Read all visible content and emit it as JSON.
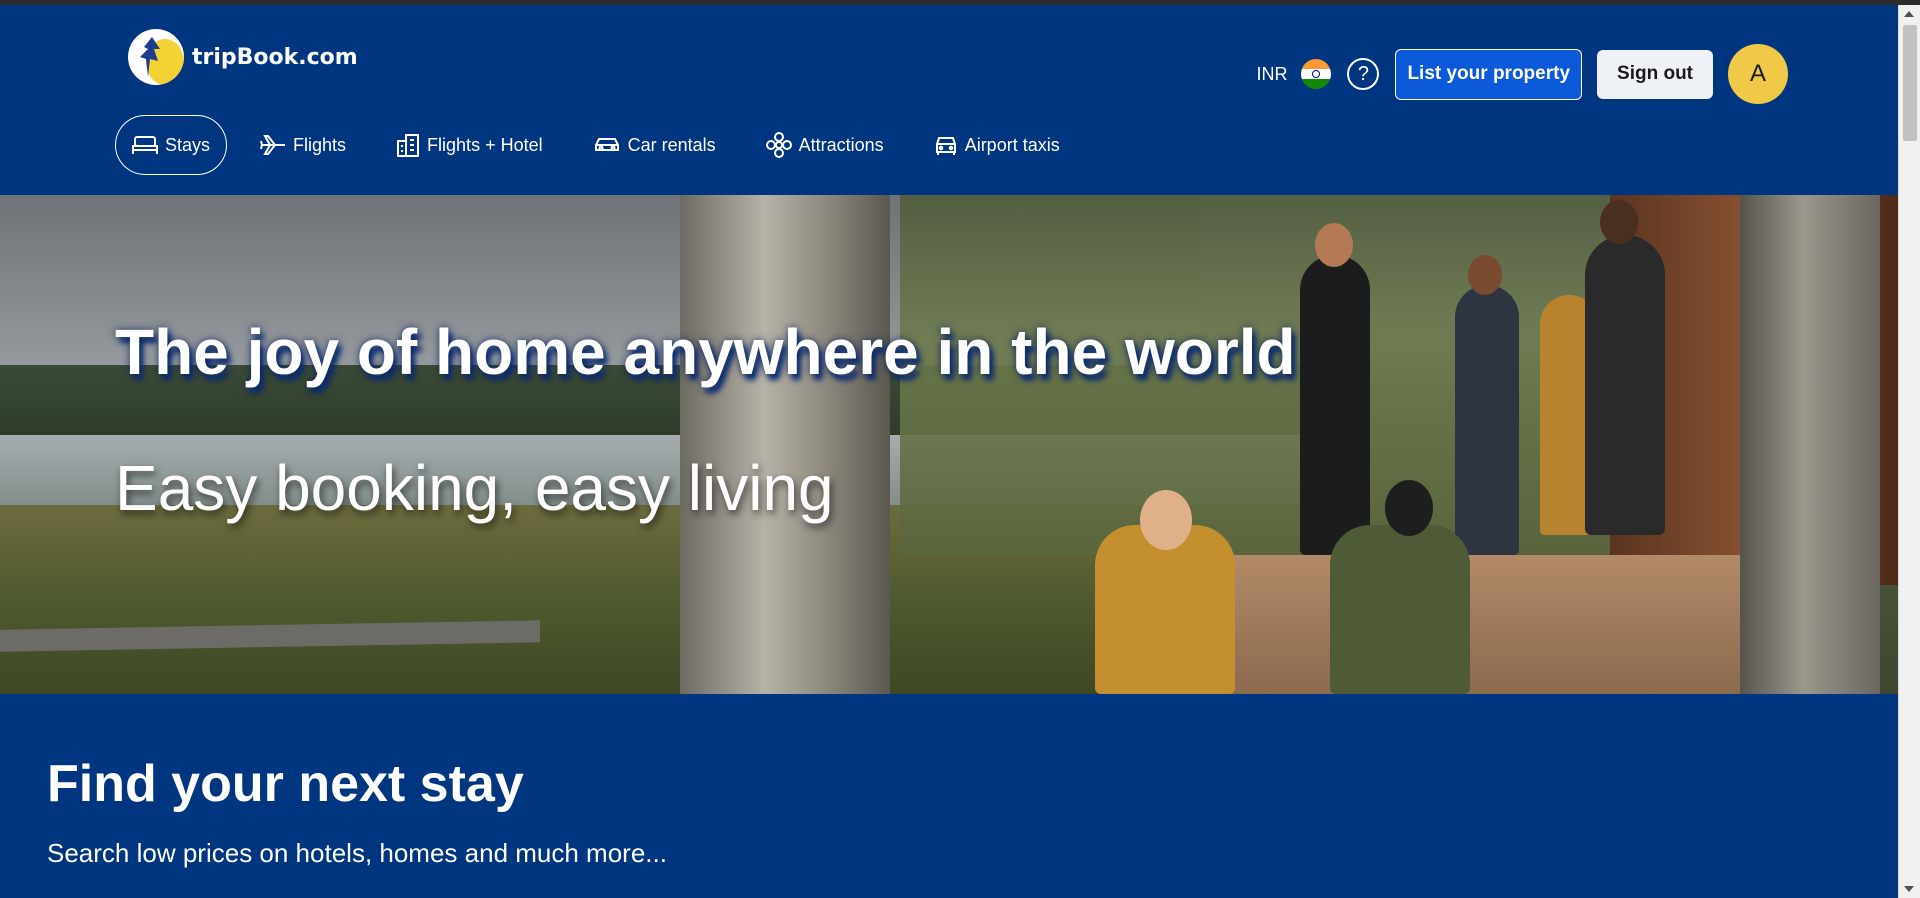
{
  "header": {
    "logo_text": "tripBook.com",
    "currency": "INR",
    "flag": "india-flag",
    "help_symbol": "?",
    "list_property_label": "List your property",
    "sign_out_label": "Sign out",
    "avatar_initial": "A"
  },
  "nav": {
    "items": [
      {
        "label": "Stays",
        "icon": "bed-icon",
        "active": true
      },
      {
        "label": "Flights",
        "icon": "plane-icon",
        "active": false
      },
      {
        "label": "Flights + Hotel",
        "icon": "building-icon",
        "active": false
      },
      {
        "label": "Car rentals",
        "icon": "car-icon",
        "active": false
      },
      {
        "label": "Attractions",
        "icon": "flower-icon",
        "active": false
      },
      {
        "label": "Airport taxis",
        "icon": "taxi-icon",
        "active": false
      }
    ]
  },
  "hero": {
    "title": "The joy of home anywhere in the world",
    "subtitle": "Easy booking, easy living"
  },
  "find": {
    "title": "Find your next stay",
    "subtitle": "Search low prices on hotels, homes and much more..."
  },
  "colors": {
    "brand_blue": "#003580",
    "button_blue": "#0b58d8",
    "avatar_yellow": "#f0c948"
  }
}
